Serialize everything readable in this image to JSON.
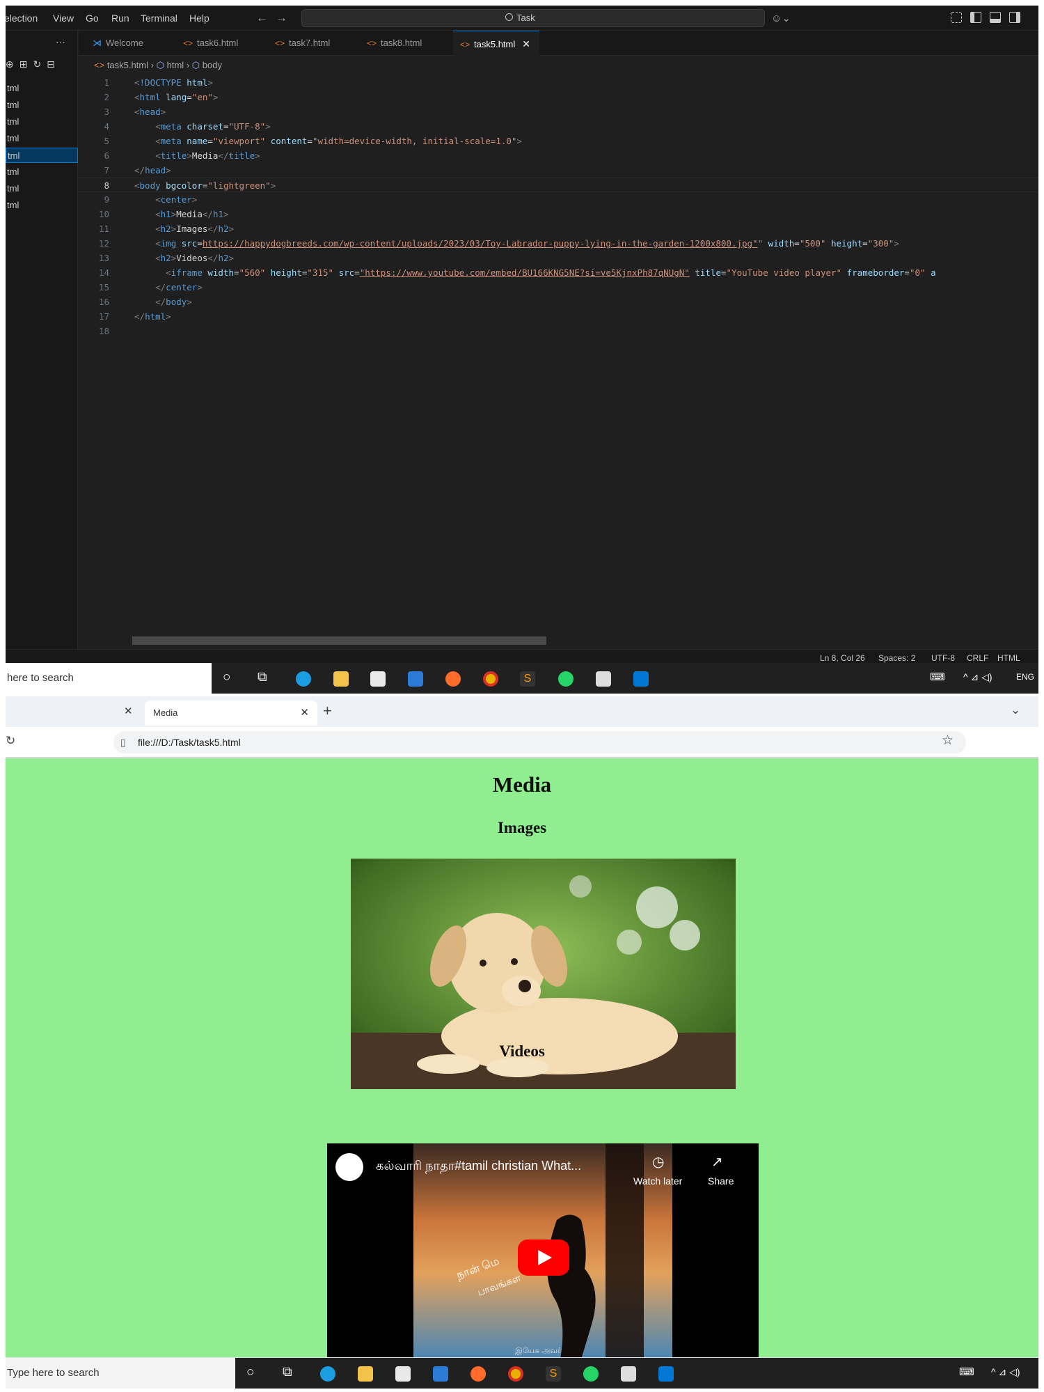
{
  "vscode": {
    "menu": [
      "election",
      "View",
      "Go",
      "Run",
      "Terminal",
      "Help"
    ],
    "command_center": "Task",
    "explorer_files": [
      "tml",
      "tml",
      "tml",
      "tml",
      "tml",
      "tml",
      "tml",
      "tml"
    ],
    "tabs": [
      "Welcome",
      "task6.html",
      "task7.html",
      "task8.html",
      "task5.html"
    ],
    "breadcrumb": [
      "task5.html",
      "html",
      "body"
    ],
    "status": {
      "position": "Ln 8, Col 26",
      "spaces": "Spaces: 2",
      "encoding": "UTF-8",
      "eol": "CRLF",
      "language": "HTML"
    }
  },
  "code_lines": [
    {
      "n": "1",
      "tokens": [
        [
          "br",
          "<"
        ],
        [
          "tg",
          "!DOCTYPE"
        ],
        [
          "tx",
          " "
        ],
        [
          "at",
          "html"
        ],
        [
          "br",
          ">"
        ]
      ]
    },
    {
      "n": "2",
      "tokens": [
        [
          "br",
          "<"
        ],
        [
          "tg",
          "html"
        ],
        [
          "tx",
          " "
        ],
        [
          "at",
          "lang"
        ],
        [
          "tx",
          "="
        ],
        [
          "st",
          "\"en\""
        ],
        [
          "br",
          ">"
        ]
      ]
    },
    {
      "n": "3",
      "tokens": [
        [
          "br",
          "<"
        ],
        [
          "tg",
          "head"
        ],
        [
          "br",
          ">"
        ]
      ]
    },
    {
      "n": "4",
      "tokens": [
        [
          "tx",
          "    "
        ],
        [
          "br",
          "<"
        ],
        [
          "tg",
          "meta"
        ],
        [
          "tx",
          " "
        ],
        [
          "at",
          "charset"
        ],
        [
          "tx",
          "="
        ],
        [
          "st",
          "\"UTF-8\""
        ],
        [
          "br",
          ">"
        ]
      ]
    },
    {
      "n": "5",
      "tokens": [
        [
          "tx",
          "    "
        ],
        [
          "br",
          "<"
        ],
        [
          "tg",
          "meta"
        ],
        [
          "tx",
          " "
        ],
        [
          "at",
          "name"
        ],
        [
          "tx",
          "="
        ],
        [
          "st",
          "\"viewport\""
        ],
        [
          "tx",
          " "
        ],
        [
          "at",
          "content"
        ],
        [
          "tx",
          "="
        ],
        [
          "st",
          "\"width=device-width, initial-scale=1.0\""
        ],
        [
          "br",
          ">"
        ]
      ]
    },
    {
      "n": "6",
      "tokens": [
        [
          "tx",
          "    "
        ],
        [
          "br",
          "<"
        ],
        [
          "tg",
          "title"
        ],
        [
          "br",
          ">"
        ],
        [
          "tx",
          "Media"
        ],
        [
          "br",
          "</"
        ],
        [
          "tg",
          "title"
        ],
        [
          "br",
          ">"
        ]
      ]
    },
    {
      "n": "7",
      "tokens": [
        [
          "br",
          "</"
        ],
        [
          "tg",
          "head"
        ],
        [
          "br",
          ">"
        ]
      ]
    },
    {
      "n": "8",
      "tokens": [
        [
          "br",
          "<"
        ],
        [
          "tg",
          "body"
        ],
        [
          "tx",
          " "
        ],
        [
          "at",
          "bgcolor"
        ],
        [
          "tx",
          "="
        ],
        [
          "st",
          "\"lightgreen\""
        ],
        [
          "br",
          ">"
        ]
      ]
    },
    {
      "n": "9",
      "tokens": [
        [
          "tx",
          "    "
        ],
        [
          "br",
          "<"
        ],
        [
          "tg",
          "center"
        ],
        [
          "br",
          ">"
        ]
      ]
    },
    {
      "n": "10",
      "tokens": [
        [
          "tx",
          "    "
        ],
        [
          "br",
          "<"
        ],
        [
          "tg",
          "h1"
        ],
        [
          "br",
          ">"
        ],
        [
          "tx",
          "Media"
        ],
        [
          "br",
          "</"
        ],
        [
          "tg",
          "h1"
        ],
        [
          "br",
          ">"
        ]
      ]
    },
    {
      "n": "11",
      "tokens": [
        [
          "tx",
          "    "
        ],
        [
          "br",
          "<"
        ],
        [
          "tg",
          "h2"
        ],
        [
          "br",
          ">"
        ],
        [
          "tx",
          "Images"
        ],
        [
          "br",
          "</"
        ],
        [
          "tg",
          "h2"
        ],
        [
          "br",
          ">"
        ]
      ]
    },
    {
      "n": "12",
      "tokens": [
        [
          "tx",
          "    "
        ],
        [
          "br",
          "<"
        ],
        [
          "tg",
          "img"
        ],
        [
          "tx",
          " "
        ],
        [
          "at",
          "src"
        ],
        [
          "tx",
          "="
        ],
        [
          "st",
          "https://happydogbreeds.com/wp-content/uploads/2023/03/Toy-Labrador-puppy-lying-in-the-garden-1200x800.jpg\""
        ],
        [
          "st",
          "\""
        ],
        [
          "tx",
          " "
        ],
        [
          "at",
          "width"
        ],
        [
          "tx",
          "="
        ],
        [
          "st",
          "\"500\""
        ],
        [
          "tx",
          " "
        ],
        [
          "at",
          "height"
        ],
        [
          "tx",
          "="
        ],
        [
          "st",
          "\"300\""
        ],
        [
          "br",
          ">"
        ]
      ]
    },
    {
      "n": "13",
      "tokens": [
        [
          "tx",
          "    "
        ],
        [
          "br",
          "<"
        ],
        [
          "tg",
          "h2"
        ],
        [
          "br",
          ">"
        ],
        [
          "tx",
          "Videos"
        ],
        [
          "br",
          "</"
        ],
        [
          "tg",
          "h2"
        ],
        [
          "br",
          ">"
        ]
      ]
    },
    {
      "n": "14",
      "tokens": [
        [
          "tx",
          "      "
        ],
        [
          "br",
          "<"
        ],
        [
          "tg",
          "iframe"
        ],
        [
          "tx",
          " "
        ],
        [
          "at",
          "width"
        ],
        [
          "tx",
          "="
        ],
        [
          "st",
          "\"560\""
        ],
        [
          "tx",
          " "
        ],
        [
          "at",
          "height"
        ],
        [
          "tx",
          "="
        ],
        [
          "st",
          "\"315\""
        ],
        [
          "tx",
          " "
        ],
        [
          "at",
          "src"
        ],
        [
          "tx",
          "="
        ],
        [
          "st",
          "\"https://www.youtube.com/embed/BU166KNG5NE?si=ve5KjnxPh87qNUgN\""
        ],
        [
          "tx",
          " "
        ],
        [
          "at",
          "title"
        ],
        [
          "tx",
          "="
        ],
        [
          "st",
          "\"YouTube video player\""
        ],
        [
          "tx",
          " "
        ],
        [
          "at",
          "frameborder"
        ],
        [
          "tx",
          "="
        ],
        [
          "st",
          "\"0\""
        ],
        [
          "tx",
          " "
        ],
        [
          "at",
          "a"
        ]
      ]
    },
    {
      "n": "15",
      "tokens": [
        [
          "tx",
          "    "
        ],
        [
          "br",
          "</"
        ],
        [
          "tg",
          "center"
        ],
        [
          "br",
          ">"
        ]
      ]
    },
    {
      "n": "16",
      "tokens": [
        [
          "tx",
          "    "
        ],
        [
          "br",
          "</"
        ],
        [
          "tg",
          "body"
        ],
        [
          "br",
          ">"
        ]
      ]
    },
    {
      "n": "17",
      "tokens": [
        [
          "br",
          "</"
        ],
        [
          "tg",
          "html"
        ],
        [
          "br",
          ">"
        ]
      ]
    },
    {
      "n": "18",
      "tokens": []
    }
  ],
  "taskbar_top": {
    "search": "here to search",
    "right": "ENG"
  },
  "taskbar_bottom": {
    "search": "Type here to search"
  },
  "browser": {
    "tab_title": "Media",
    "url": "file:///D:/Task/task5.html",
    "page": {
      "h1": "Media",
      "h2_images": "Images",
      "h2_videos": "Videos"
    },
    "video": {
      "title": "கல்வாரி நாதா#tamil christian What...",
      "watch_later": "Watch later",
      "share": "Share",
      "overlay_line1": "நான் மெ",
      "overlay_line2": "பாவங்கள",
      "overlay_bottom": "இயேசு அவர்"
    }
  }
}
